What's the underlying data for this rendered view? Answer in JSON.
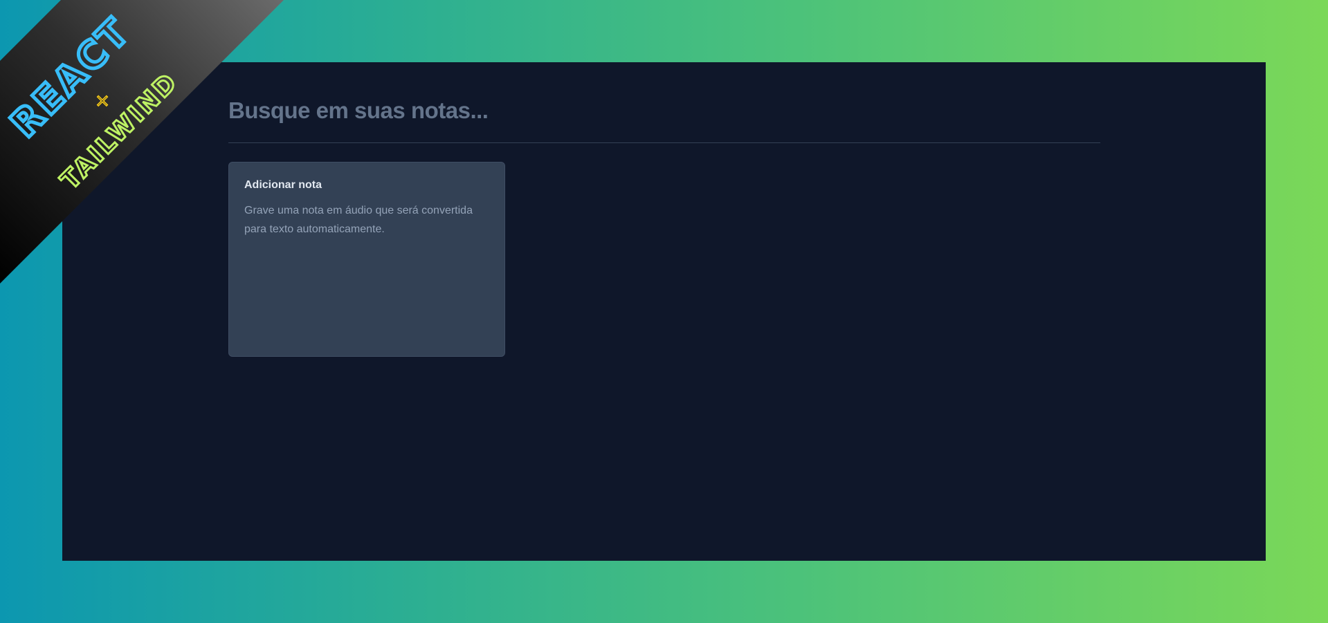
{
  "search": {
    "placeholder": "Busque em suas notas...",
    "value": ""
  },
  "add_note_card": {
    "title": "Adicionar nota",
    "description": "Grave uma nota em áudio que será convertida para texto automaticamente."
  },
  "ribbon": {
    "line1": "REACT",
    "separator": "×",
    "line2": "TAILWIND",
    "colors": {
      "react": "#38bdf8",
      "tailwind": "#bef264",
      "separator": "#facc15"
    }
  },
  "colors": {
    "background_gradient": [
      "#0c97b0",
      "#2bae93",
      "#4cc27a",
      "#7bd858"
    ],
    "app_background": "#0f172a",
    "card_background": "#334155",
    "muted_text": "#94a3b8",
    "placeholder_text": "#64748b"
  }
}
